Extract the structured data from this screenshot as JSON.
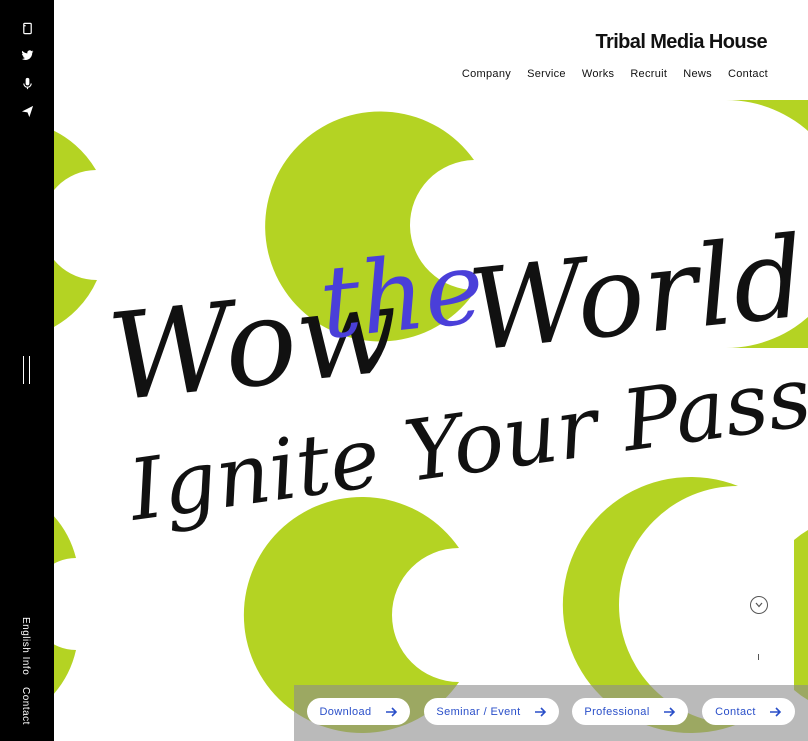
{
  "brand": {
    "name": "Tribal Media House"
  },
  "nav": {
    "items": [
      "Company",
      "Service",
      "Works",
      "Recruit",
      "News",
      "Contact"
    ]
  },
  "sidebar": {
    "icons": [
      "note-icon",
      "twitter-icon",
      "microphone-icon",
      "send-icon"
    ],
    "links": {
      "english_info": "English Info",
      "contact": "Contact"
    }
  },
  "hero": {
    "line1a": "Wow",
    "line1b": "the",
    "line1c": "World,",
    "line2": "Ignite Your Passion!",
    "accent_color": "#4a3fd9",
    "circle_color": "#b4d323"
  },
  "cta": {
    "download": "Download",
    "seminar": "Seminar / Event",
    "professional": "Professional",
    "contact": "Contact"
  },
  "colors": {
    "sidebar_bg": "#000000",
    "cta_text": "#2a4fc9"
  }
}
